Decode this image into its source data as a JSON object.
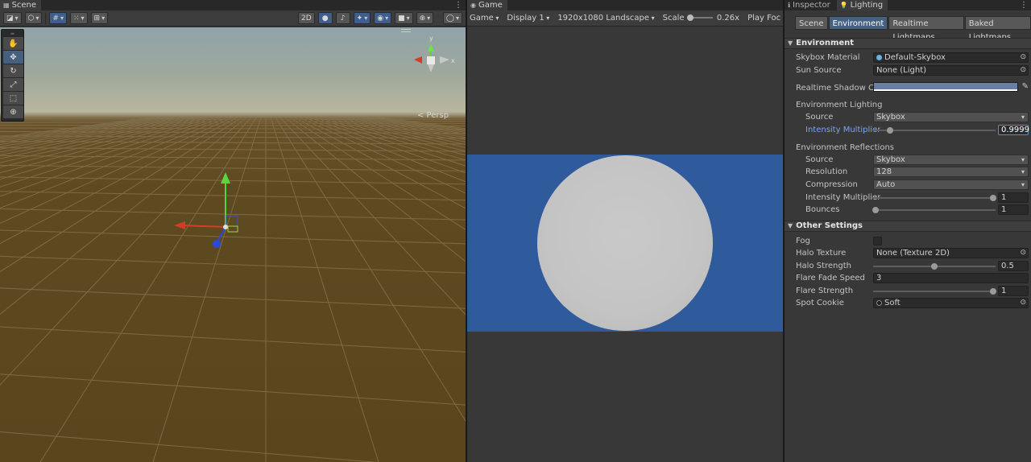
{
  "scene": {
    "tab_label": "Scene",
    "toolbar": {
      "mode_2d": "2D"
    },
    "perspective_label": "< Persp",
    "tools": [
      {
        "name": "hand-tool",
        "glyph": "✋"
      },
      {
        "name": "move-tool",
        "glyph": "✥"
      },
      {
        "name": "rotate-tool",
        "glyph": "↻"
      },
      {
        "name": "scale-tool",
        "glyph": "⤢"
      },
      {
        "name": "rect-tool",
        "glyph": "⬚"
      },
      {
        "name": "transform-tool",
        "glyph": "⊕"
      }
    ]
  },
  "game": {
    "tab_label": "Game",
    "mode": "Game",
    "display": "Display 1",
    "resolution": "1920x1080 Landscape",
    "scale_label": "Scale",
    "scale_value": "0.26x",
    "play_focused": "Play Foc"
  },
  "inspector": {
    "tabs": [
      "Inspector",
      "Lighting"
    ],
    "subtabs": [
      "Scene",
      "Environment",
      "Realtime Lightmaps",
      "Baked Lightmaps"
    ],
    "environment": {
      "header": "Environment",
      "skybox_material_label": "Skybox Material",
      "skybox_material_value": "Default-Skybox",
      "sun_source_label": "Sun Source",
      "sun_source_value": "None (Light)",
      "shadow_color_label": "Realtime Shadow Color",
      "shadow_color": "#6b7fa6",
      "lighting_header": "Environment Lighting",
      "lighting_source_label": "Source",
      "lighting_source_value": "Skybox",
      "intensity_label": "Intensity Multiplier",
      "intensity_value": "0.9999",
      "intensity_fraction": 0.14,
      "reflections_header": "Environment Reflections",
      "refl_source_label": "Source",
      "refl_source_value": "Skybox",
      "resolution_label": "Resolution",
      "resolution_value": "128",
      "compression_label": "Compression",
      "compression_value": "Auto",
      "refl_intensity_label": "Intensity Multiplier",
      "refl_intensity_value": "1",
      "refl_intensity_fraction": 0.98,
      "bounces_label": "Bounces",
      "bounces_value": "1",
      "bounces_fraction": 0.02
    },
    "other": {
      "header": "Other Settings",
      "fog_label": "Fog",
      "halo_texture_label": "Halo Texture",
      "halo_texture_value": "None (Texture 2D)",
      "halo_strength_label": "Halo Strength",
      "halo_strength_value": "0.5",
      "halo_strength_fraction": 0.5,
      "flare_fade_label": "Flare Fade Speed",
      "flare_fade_value": "3",
      "flare_strength_label": "Flare Strength",
      "flare_strength_value": "1",
      "flare_strength_fraction": 0.98,
      "spot_cookie_label": "Spot Cookie",
      "spot_cookie_value": "Soft"
    }
  }
}
